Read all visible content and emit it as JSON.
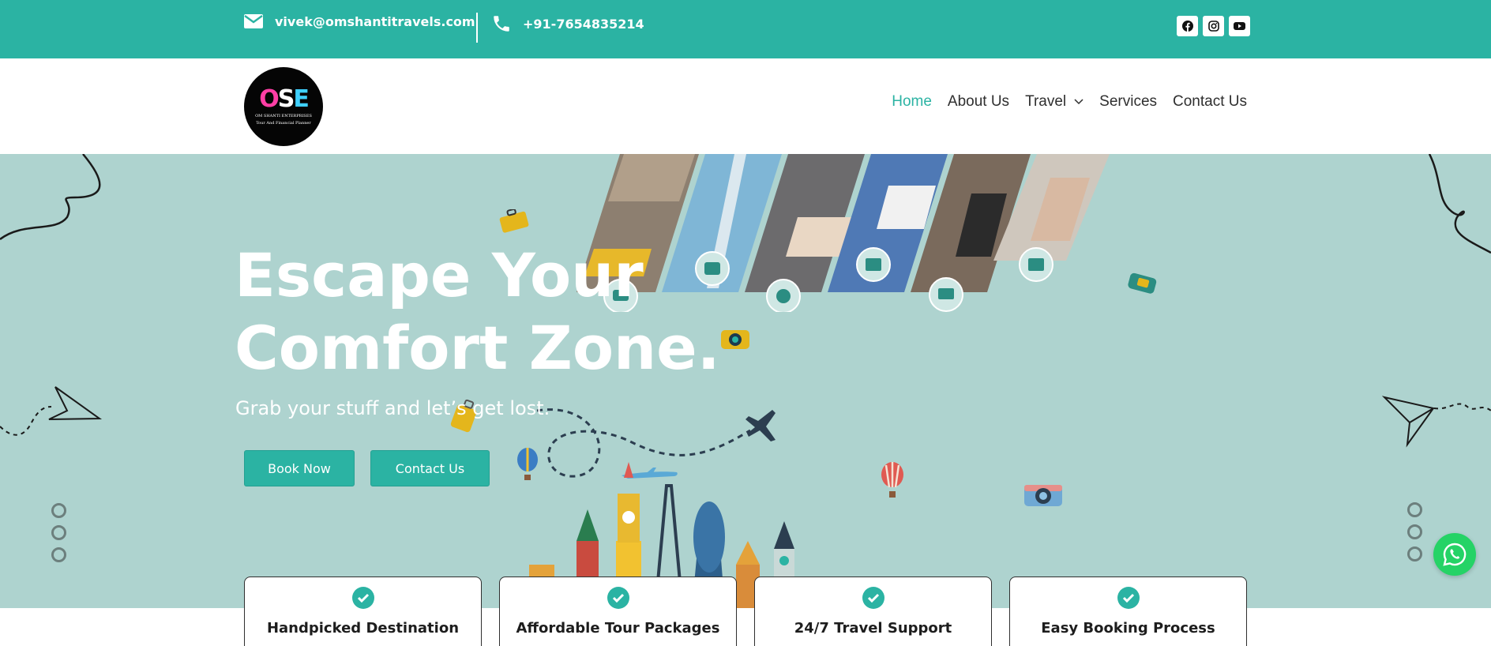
{
  "topbar": {
    "email": "vivek@omshantitravels.com",
    "phone": "+91-7654835214",
    "socials": [
      "facebook-icon",
      "instagram-icon",
      "youtube-icon"
    ]
  },
  "header": {
    "logo": {
      "mark": [
        "O",
        "S",
        "E"
      ],
      "name": "OM SHANTI ENTERPRISES",
      "tagline": "Tour And Financial Planner"
    },
    "nav": {
      "home": "Home",
      "about": "About Us",
      "travel": "Travel",
      "services": "Services",
      "contact": "Contact Us"
    }
  },
  "hero": {
    "title_line1": "Escape Your",
    "title_line2": "Comfort Zone.",
    "subtitle": "Grab your stuff and let’s get lost.",
    "book_button": "Book Now",
    "contact_button": "Contact Us"
  },
  "features": [
    {
      "title": "Handpicked Destination"
    },
    {
      "title": "Affordable Tour Packages"
    },
    {
      "title": "24/7 Travel Support"
    },
    {
      "title": "Easy Booking Process"
    }
  ],
  "colors": {
    "accent": "#2bb3a3",
    "hero_bg": "#aed3cf",
    "text_dark": "#2f2f2f",
    "whatsapp": "#25d366"
  }
}
